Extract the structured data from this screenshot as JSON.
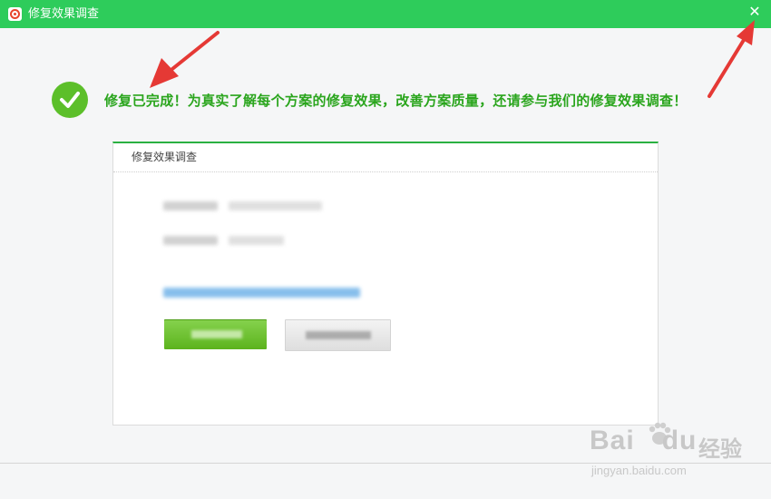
{
  "window": {
    "title": "修复效果调查",
    "close_symbol": "✕",
    "accent_color": "#2ecc5b"
  },
  "banner": {
    "icon": "check-circle-icon",
    "message": "修复已完成！为真实了解每个方案的修复效果，改善方案质量，还请参与我们的修复效果调查！",
    "text_color": "#2aa51d"
  },
  "survey_panel": {
    "header": "修复效果调查",
    "rows_blurred": 2,
    "buttons_blurred": 2
  },
  "watermark": {
    "brand": "Bai",
    "brand_suffix": "du",
    "cn_text": "经验",
    "url": "jingyan.baidu.com"
  }
}
